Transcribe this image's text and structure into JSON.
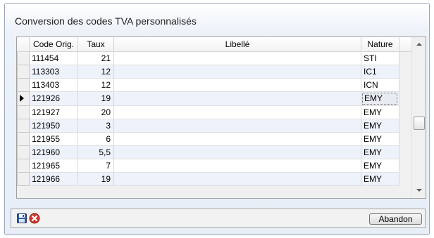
{
  "window": {
    "title": "Conversion des codes TVA personnalisés"
  },
  "grid": {
    "columns": {
      "code": "Code Orig.",
      "rate": "Taux",
      "label": "Libellé",
      "nature": "Nature"
    },
    "rows": [
      {
        "code": "111454",
        "rate": "21",
        "label": "",
        "nature": "STI"
      },
      {
        "code": "113303",
        "rate": "12",
        "label": "",
        "nature": "IC1"
      },
      {
        "code": "113403",
        "rate": "12",
        "label": "",
        "nature": "ICN"
      },
      {
        "code": "121926",
        "rate": "19",
        "label": "",
        "nature": "EMY"
      },
      {
        "code": "121927",
        "rate": "20",
        "label": "",
        "nature": "EMY"
      },
      {
        "code": "121950",
        "rate": "3",
        "label": "",
        "nature": "EMY"
      },
      {
        "code": "121955",
        "rate": "6",
        "label": "",
        "nature": "EMY"
      },
      {
        "code": "121960",
        "rate": "5,5",
        "label": "",
        "nature": "EMY"
      },
      {
        "code": "121965",
        "rate": "7",
        "label": "",
        "nature": "EMY"
      },
      {
        "code": "121966",
        "rate": "19",
        "label": "",
        "nature": "EMY"
      }
    ],
    "current_row_index": 3
  },
  "toolbar": {
    "save_icon": "floppy-disk-icon",
    "cancel_icon": "red-cancel-icon",
    "abandon_label": "Abandon"
  }
}
